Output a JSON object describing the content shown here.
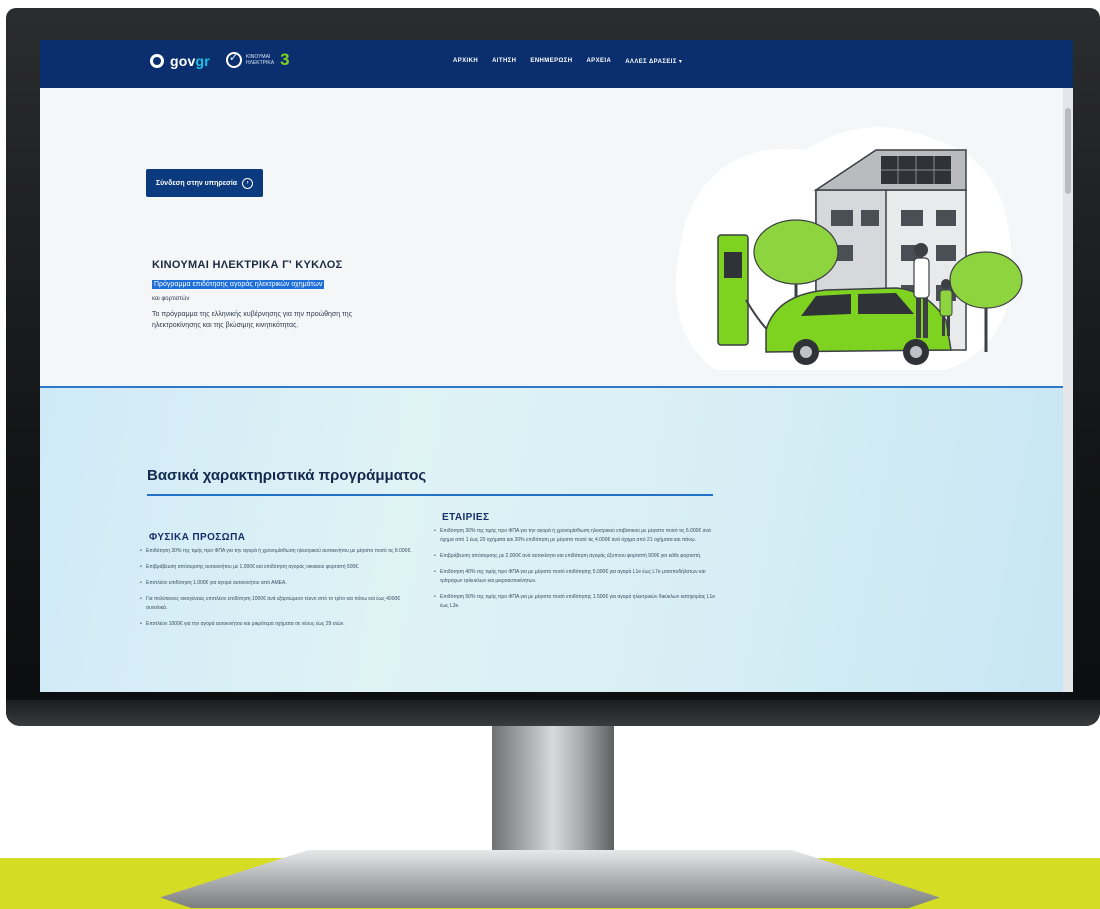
{
  "nav": {
    "gov_logo": "gov",
    "gov_logo_suffix": "gr",
    "program_logo_line1": "ΚΙΝΟΥΜΑΙ",
    "program_logo_line2": "ΗΛΕΚΤΡΙΚΑ",
    "program_logo_number": "3",
    "menu": [
      "ΑΡΧΙΚΗ",
      "ΑΙΤΗΣΗ",
      "ΕΝΗΜΕΡΩΣΗ",
      "ΑΡΧΕΙΑ",
      "ΑΛΛΕΣ ΔΡΑΣΕΙΣ ▾"
    ]
  },
  "hero": {
    "login_button": "Σύνδεση στην υπηρεσία",
    "title": "ΚΙΝΟΥΜΑΙ ΗΛΕΚΤΡΙΚΑ Γ' ΚΥΚΛΟΣ",
    "highlight": "Πρόγραμμα επιδότησης αγοράς ηλεκτρικών οχημάτων",
    "subtitle": "και φορτιστών",
    "description": "Το πρόγραμμα της ελληνικής κυβέρνησης για την προώθηση της ηλεκτροκίνησης και της βιώσιμης κινητικότητας."
  },
  "features": {
    "title": "Βασικά χαρακτηριστικά προγράμματος",
    "individuals": {
      "title": "ΦΥΣΙΚΑ ΠΡΟΣΩΠΑ",
      "items": [
        "Επιδότηση 30% της τιμής προ ΦΠΑ για την αγορά ή χρονομίσθωση ηλεκτρικού αυτοκινήτου με μέγιστο ποσό τις 8.000€.",
        "Επιβράβευση απόσυρσης αυτοκινήτου με 1.000€ και επιδότηση αγοράς οικιακού φορτιστή 500€.",
        "Επιπλέον επιδότηση 1.000€ για αγορά αυτοκινήτου από ΑΜΕΑ.",
        "Για πολύτεκνες οικογένειες επιπλέον επιδότηση 1000€ ανά εξαρτώμενο τέκνο από το τρίτο και πάνω και έως 4000€ συνολικά.",
        "Επιπλέον 1000€ για την αγορά αυτοκινήτου και μικρότερα οχήματα σε νέους έως 29 ετών."
      ]
    },
    "companies": {
      "title": "ΕΤΑΙΡΙΕΣ",
      "items": [
        "Επιδότηση 30% της τιμής προ ΦΠΑ για την αγορά ή χρονομίσθωση ηλεκτρικού επιβατικού με μέγιστο ποσό τις 6.000€ ανά όχημα από 1 έως 20 οχήματα και 20% επιδότηση με μέγιστο ποσό τις 4.000€ ανά όχημα από 21 οχήματα και πάνω.",
        "Επιβράβευση απόσυρσης με 2.000€ ανά αυτοκίνητο και επιδότηση αγοράς έξυπνου φορτιστή 900€ για κάθε φορτιστή.",
        "Επιδότηση 40% της τιμής προ ΦΠΑ για με μέγιστο ποσό επιδότησης 5.000€ για αγορά L1e έως L7e μοτοποδήλατων και τρίτροχων τρίκυκλων και μικροαυτοκίνητων.",
        "Επιδότηση 50% της τιμής προ ΦΠΑ για με μέγιστο ποσό επιδότησης 1.500€ για αγορά ηλεκτρικών δικύκλων κατηγορίας L1e έως L3e."
      ]
    }
  },
  "colors": {
    "navbar": "#0b2f6e",
    "accent_green": "#7ed321",
    "highlight_blue": "#1f6fd8",
    "desk_yellow": "#d4dc24"
  }
}
